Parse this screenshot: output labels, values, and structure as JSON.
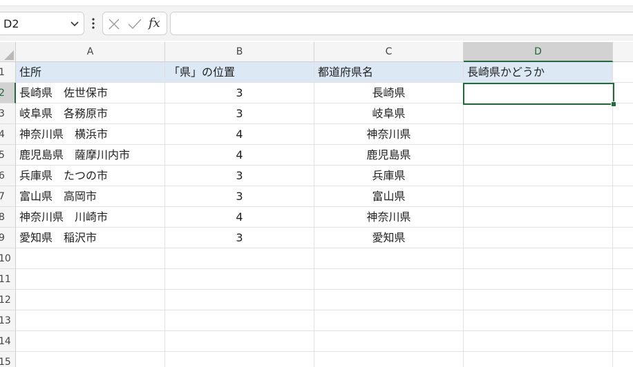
{
  "name_box": {
    "value": "D2"
  },
  "formula_bar": {
    "value": "",
    "fx_label": "fx"
  },
  "columns": [
    "A",
    "B",
    "C",
    "D"
  ],
  "active_column": "D",
  "active_row": "2",
  "row_numbers": [
    "1",
    "2",
    "3",
    "4",
    "5",
    "6",
    "7",
    "8",
    "9",
    "10",
    "11",
    "12",
    "13",
    "14",
    "15"
  ],
  "rows": [
    [
      "住所",
      "「県」の位置",
      "都道府県名",
      "長崎県かどうか"
    ],
    [
      "長崎県　佐世保市",
      "3",
      "長崎県",
      ""
    ],
    [
      "岐阜県　各務原市",
      "3",
      "岐阜県",
      ""
    ],
    [
      "神奈川県　横浜市",
      "4",
      "神奈川県",
      ""
    ],
    [
      "鹿児島県　薩摩川内市",
      "4",
      "鹿児島県",
      ""
    ],
    [
      "兵庫県　たつの市",
      "3",
      "兵庫県",
      ""
    ],
    [
      "富山県　高岡市",
      "3",
      "富山県",
      ""
    ],
    [
      "神奈川県　川崎市",
      "4",
      "神奈川県",
      ""
    ],
    [
      "愛知県　稲沢市",
      "3",
      "愛知県",
      ""
    ],
    [
      "",
      "",
      "",
      ""
    ],
    [
      "",
      "",
      "",
      ""
    ],
    [
      "",
      "",
      "",
      ""
    ],
    [
      "",
      "",
      "",
      ""
    ],
    [
      "",
      "",
      "",
      ""
    ],
    [
      "",
      "",
      "",
      ""
    ]
  ],
  "colors": {
    "accent": "#1e6b3c",
    "header_fill": "#dce9f5"
  }
}
